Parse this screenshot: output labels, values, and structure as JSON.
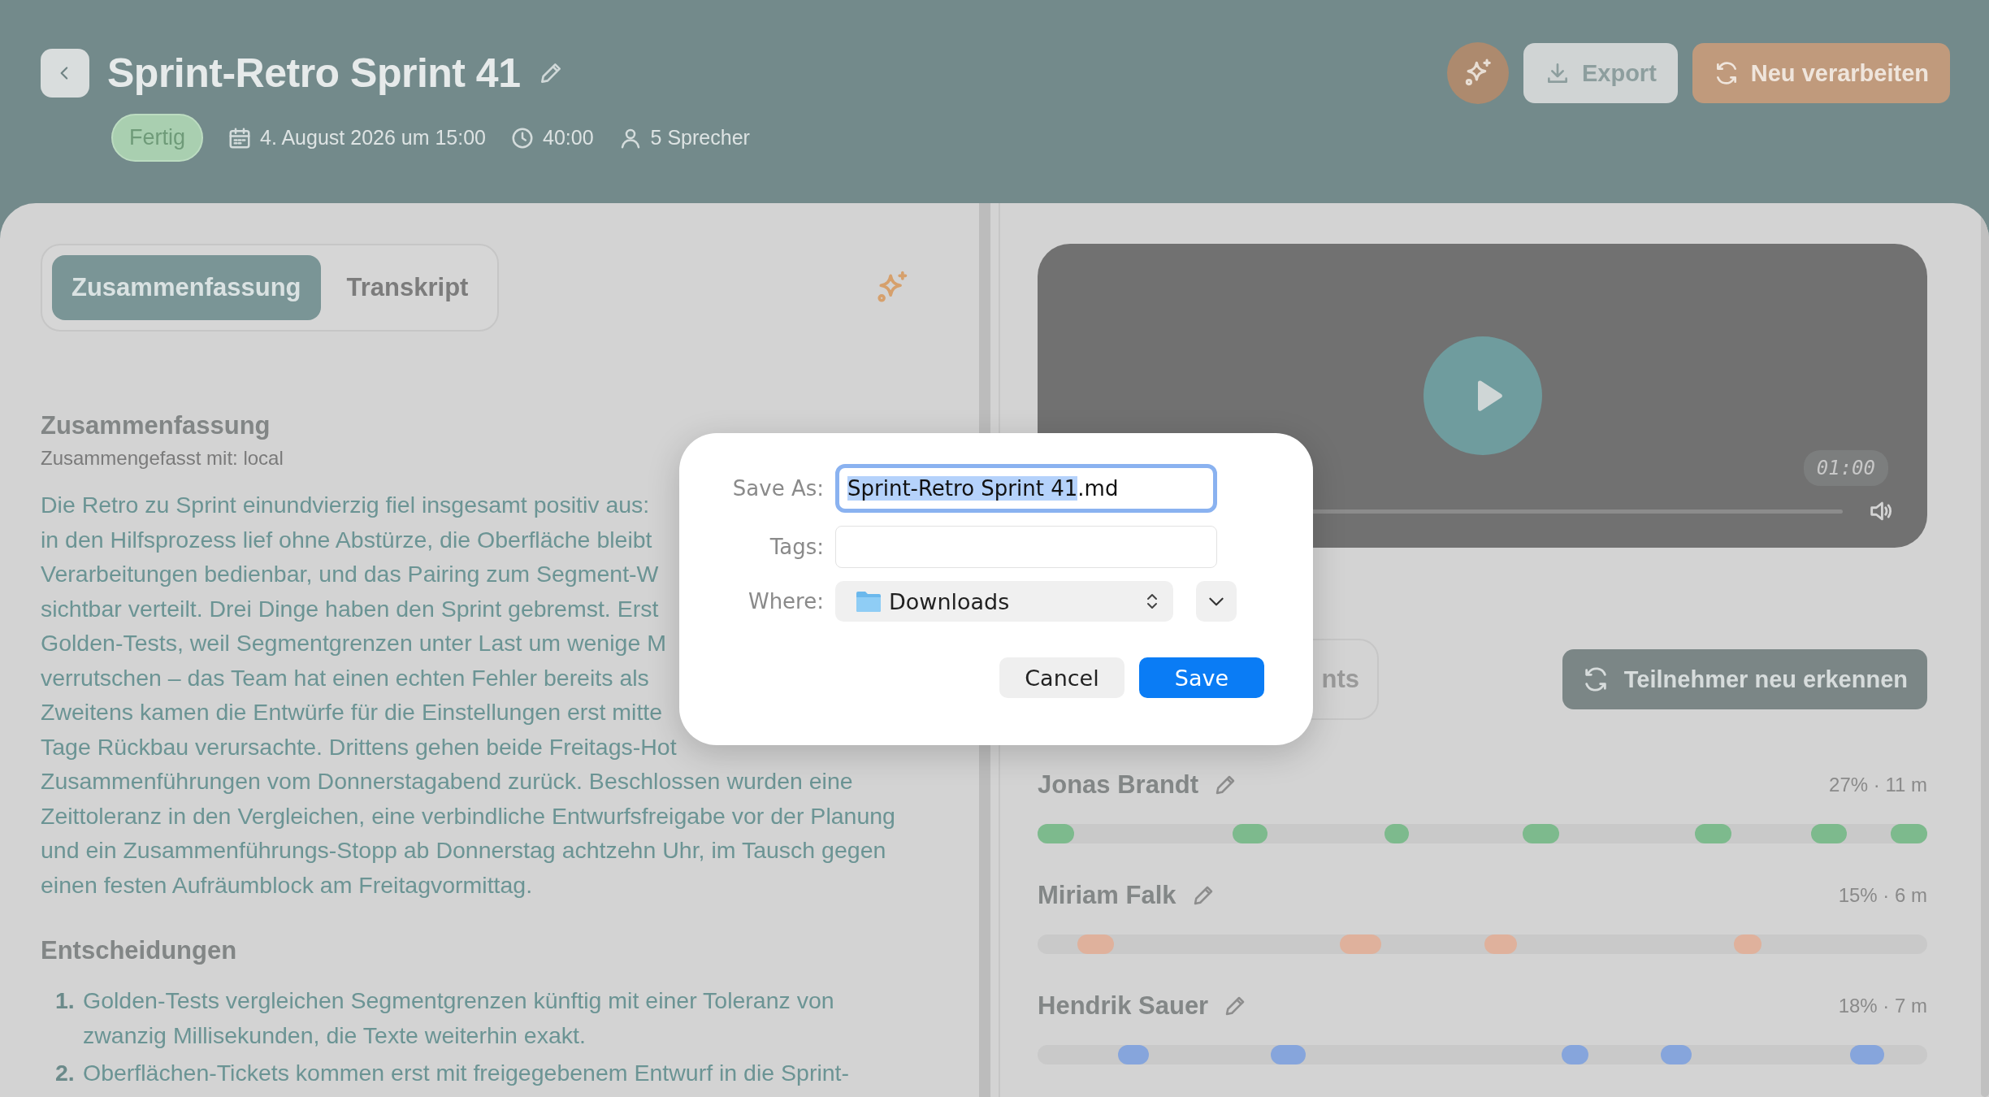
{
  "header": {
    "title": "Sprint-Retro Sprint 41",
    "status": "Fertig",
    "date": "4. August 2026 um 15:00",
    "duration": "40:00",
    "speakers": "5 Sprecher",
    "buttons": [
      {
        "kind": "ai"
      },
      {
        "kind": "export",
        "label": "Export"
      },
      {
        "kind": "reprocess",
        "label": "Neu verarbeiten"
      }
    ]
  },
  "tabs": [
    {
      "label": "Zusammenfassung",
      "selected": true
    },
    {
      "label": "Transkript",
      "selected": false
    }
  ],
  "summary": {
    "heading": "Zusammenfassung",
    "subtitle": "Zusammengefasst mit: local",
    "lines": [
      "Die Retro zu Sprint einundvierzig fiel insgesamt positiv aus:",
      "in den Hilfsprozess lief ohne Abstürze, die Oberfläche bleibt",
      "Verarbeitungen bedienbar, und das Pairing zum Segment-W",
      "sichtbar verteilt. Drei Dinge haben den Sprint gebremst. Erst",
      "Golden-Tests, weil Segmentgrenzen unter Last um wenige M",
      "verrutschen – das Team hat einen echten Fehler bereits als",
      "Zweitens kamen die Entwürfe für die Einstellungen erst mitte",
      "Tage Rückbau verursachte. Drittens gehen beide Freitags-Hot",
      "Zusammenführungen vom Donnerstagabend zurück. Beschlossen wurden eine",
      "Zeittoleranz in den Vergleichen, eine verbindliche Entwurfsfreigabe vor der Planung",
      "und ein Zusammenführungs-Stopp ab Donnerstag achtzehn Uhr, im Tausch gegen",
      "einen festen Aufräumblock am Freitagvormittag."
    ]
  },
  "decisions": {
    "heading": "Entscheidungen",
    "items": [
      {
        "number": "1.",
        "lines": [
          "Golden-Tests vergleichen Segmentgrenzen künftig mit einer Toleranz von",
          "zwanzig Millisekunden, die Texte weiterhin exakt."
        ]
      },
      {
        "number": "2.",
        "lines": [
          "Oberflächen-Tickets kommen erst mit freigegebenem Entwurf in die Sprint-"
        ]
      }
    ]
  },
  "player": {
    "time": "01:00"
  },
  "right_tab": {
    "label": "nts"
  },
  "redetect_button": "Teilnehmer neu erkennen",
  "speakers": [
    {
      "name": "Jonas Brandt",
      "stats": "27% · 11 m",
      "color": "#7dba8d"
    },
    {
      "name": "Miriam Falk",
      "stats": "15% · 6 m",
      "color": "#dfb19c"
    },
    {
      "name": "Hendrik Sauer",
      "stats": "18% · 7 m",
      "color": "#86a5dc"
    }
  ],
  "dialog": {
    "save_as_label": "Save As:",
    "save_as_selected": "Sprint-Retro Sprint 41",
    "save_as_rest": ".md",
    "tags_label": "Tags:",
    "where_label": "Where:",
    "where_value": "Downloads",
    "cancel": "Cancel",
    "save": "Save"
  }
}
